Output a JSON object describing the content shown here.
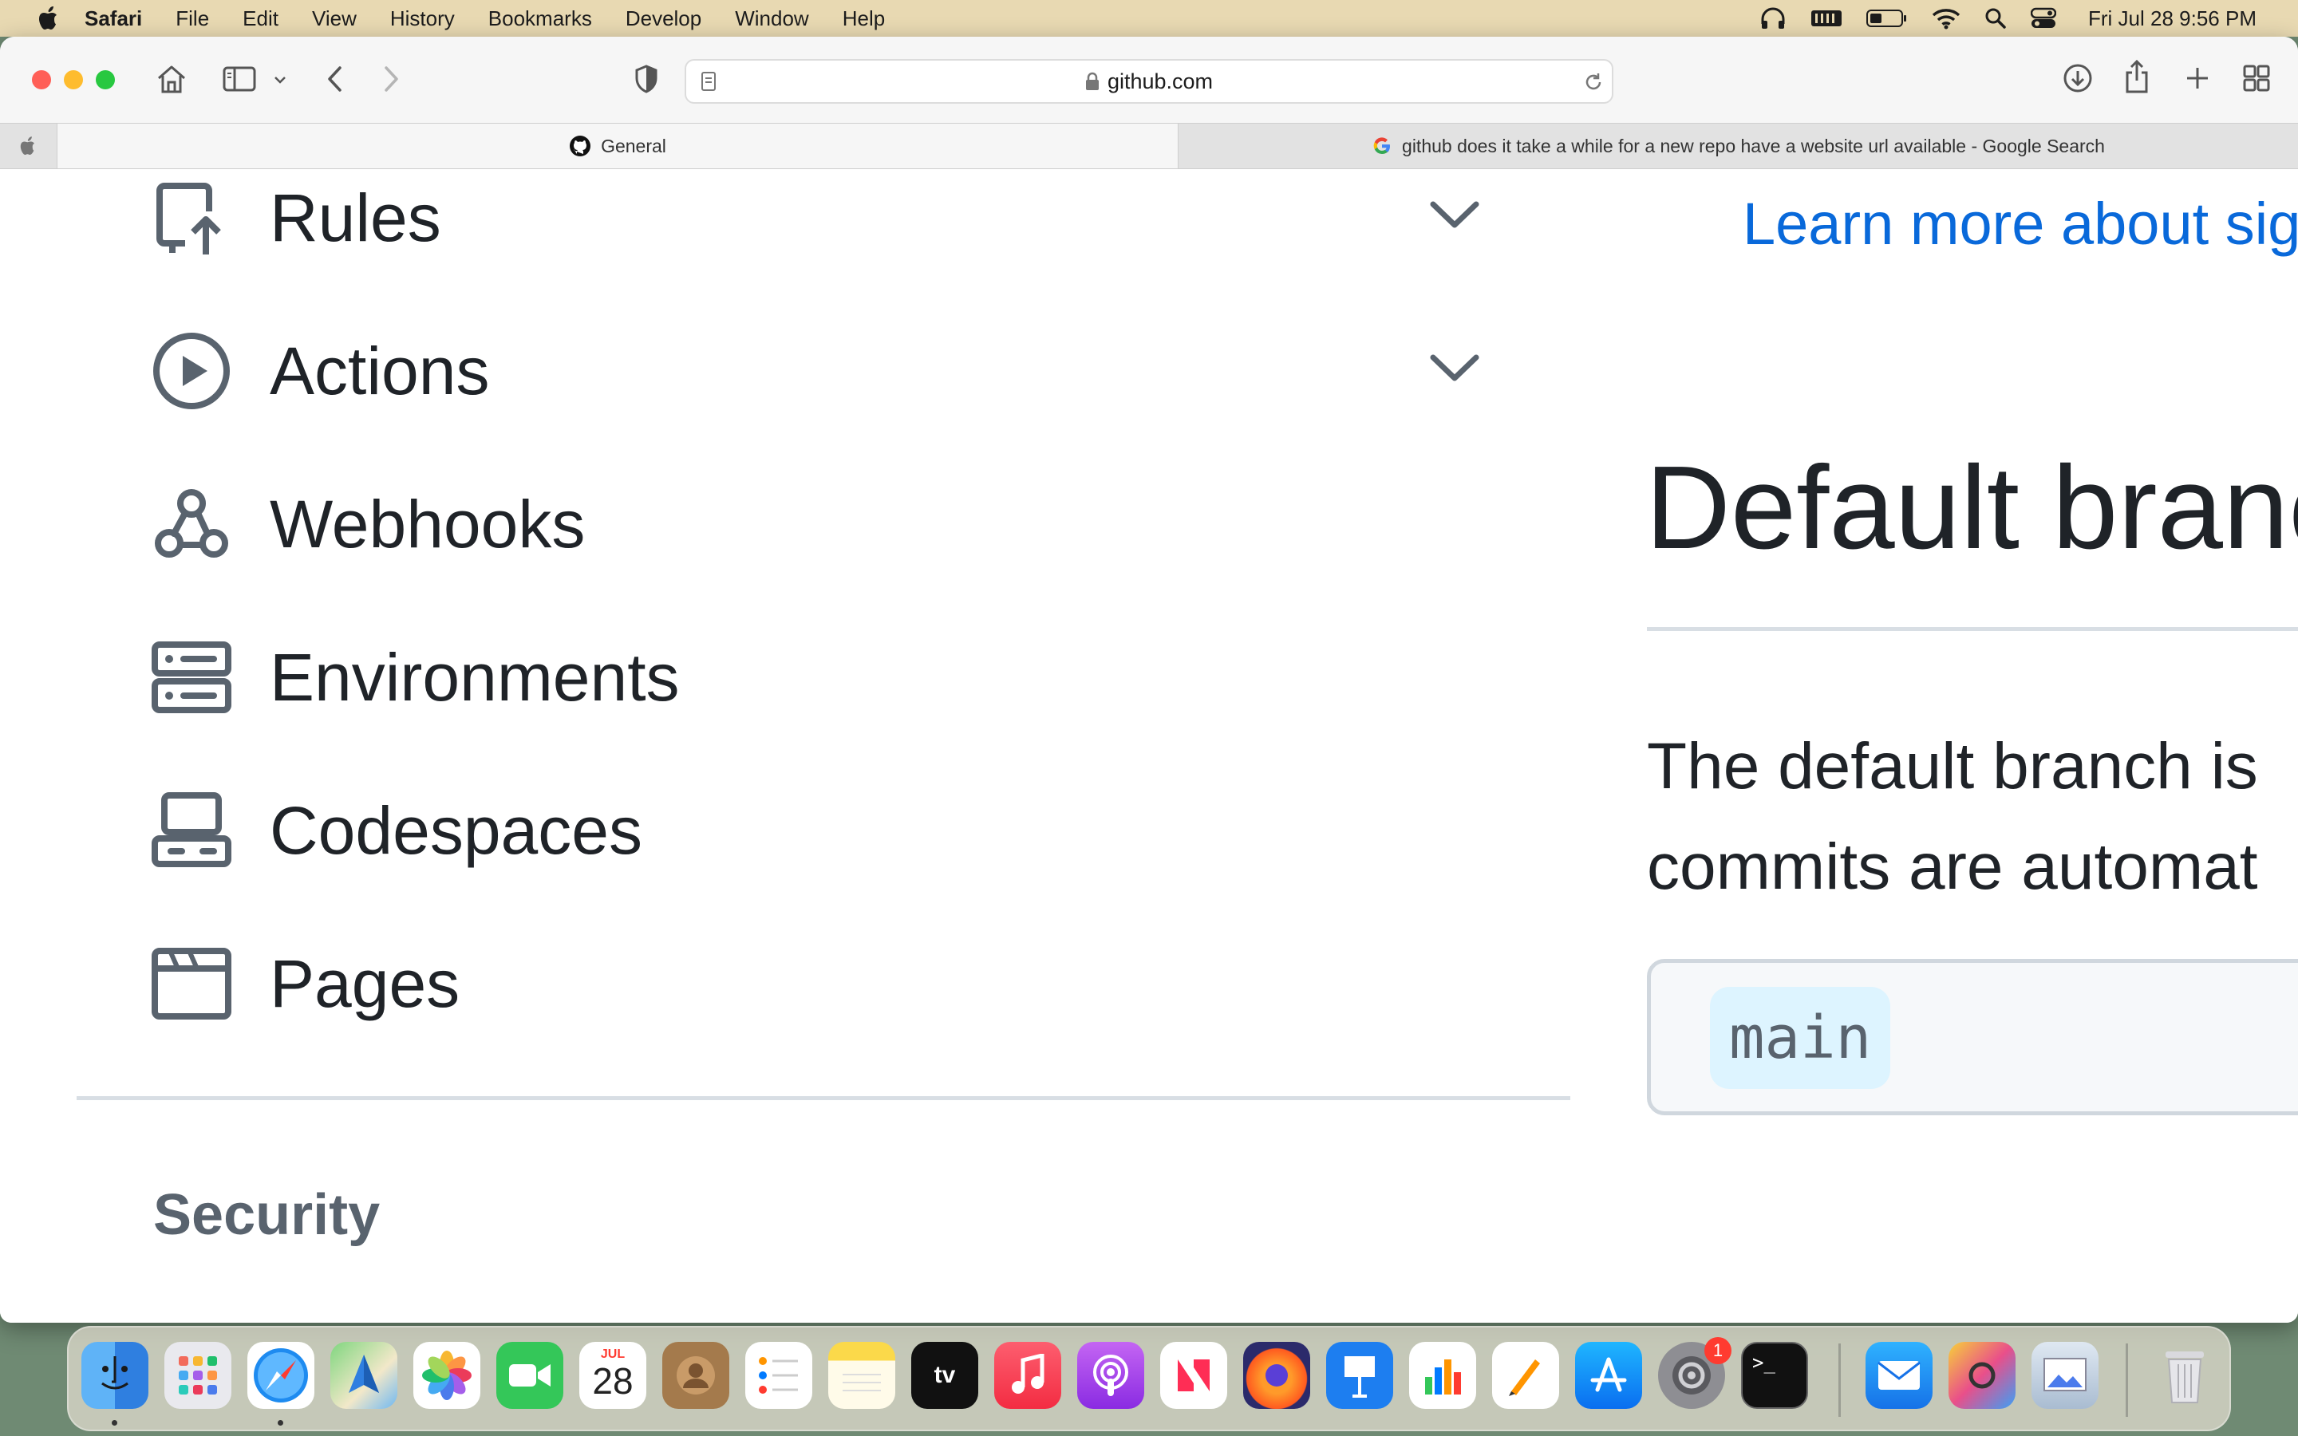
{
  "menubar": {
    "app_name": "Safari",
    "items": [
      "File",
      "Edit",
      "View",
      "History",
      "Bookmarks",
      "Develop",
      "Window",
      "Help"
    ],
    "clock": "Fri Jul 28  9:56 PM"
  },
  "browser": {
    "url": "github.com",
    "tabs": [
      {
        "label": "General"
      },
      {
        "label": "github does it take a while for a new repo have a website url available - Google Search"
      }
    ]
  },
  "sidebar": {
    "items": [
      {
        "label": "Rules",
        "icon": "rules-icon",
        "expandable": true
      },
      {
        "label": "Actions",
        "icon": "play-icon",
        "expandable": true
      },
      {
        "label": "Webhooks",
        "icon": "webhook-icon",
        "expandable": false
      },
      {
        "label": "Environments",
        "icon": "server-icon",
        "expandable": false
      },
      {
        "label": "Codespaces",
        "icon": "codespaces-icon",
        "expandable": false
      },
      {
        "label": "Pages",
        "icon": "browser-icon",
        "expandable": false
      }
    ],
    "section_heading": "Security"
  },
  "main": {
    "learn_more_link": "Learn more about sig",
    "heading": "Default branc",
    "description_line1": "The default branch is",
    "description_line2": "commits are automat",
    "branch_name": "main"
  },
  "dock": {
    "calendar_month": "JUL",
    "calendar_day": "28",
    "settings_badge": "1",
    "apps": [
      "Finder",
      "Launchpad",
      "Safari",
      "Maps",
      "Photos",
      "FaceTime",
      "Calendar",
      "Contacts",
      "Reminders",
      "Notes",
      "Apple TV",
      "Music",
      "Podcasts",
      "News",
      "Firefox",
      "Keynote",
      "Numbers",
      "Pages",
      "App Store",
      "System Settings",
      "Terminal",
      "Mail",
      "ColorSync Utility",
      "Preview",
      "Trash"
    ]
  },
  "colors": {
    "link": "#0969da",
    "text": "#1f2328",
    "muted": "#59636e",
    "menubar": "#e8d9b2"
  }
}
